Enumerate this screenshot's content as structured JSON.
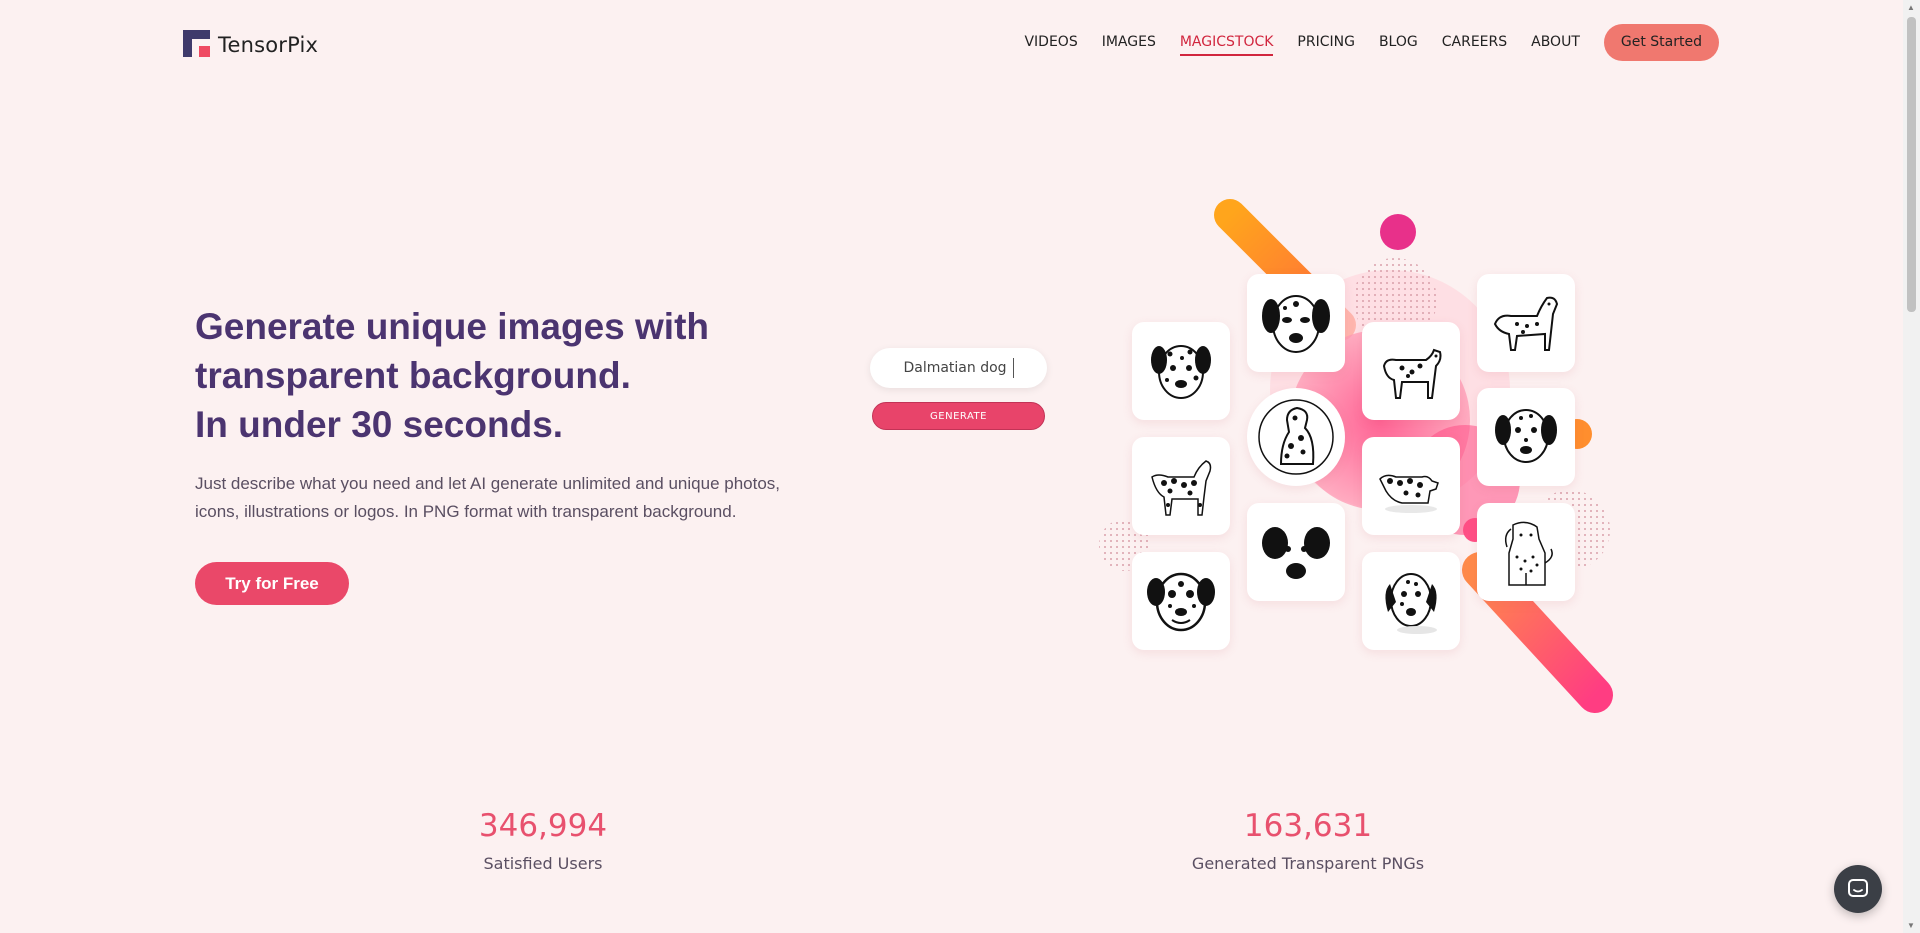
{
  "brand": {
    "name": "TensorPix"
  },
  "nav": {
    "items": [
      {
        "label": "VIDEOS"
      },
      {
        "label": "IMAGES"
      },
      {
        "label": "MAGICSTOCK",
        "active": true
      },
      {
        "label": "PRICING"
      },
      {
        "label": "BLOG"
      },
      {
        "label": "CAREERS"
      },
      {
        "label": "ABOUT"
      }
    ],
    "cta_label": "Get Started"
  },
  "hero": {
    "title_lines": [
      "Generate unique images with",
      "transparent background.",
      "In under 30 seconds."
    ],
    "description_lines": [
      "Just describe what you need and let AI generate unlimited and unique photos,",
      "icons, illustrations or logos. In PNG format with transparent background."
    ],
    "cta_label": "Try for Free"
  },
  "generator": {
    "prompt_value": "Dalmatian dog",
    "button_label": "GENERATE"
  },
  "gallery": {
    "tiles": [
      {
        "icon": "dalmatian-face-icon"
      },
      {
        "icon": "dalmatian-face-icon"
      },
      {
        "icon": "dalmatian-standing-icon"
      },
      {
        "icon": "dalmatian-outline-icon"
      },
      {
        "icon": "dalmatian-sitting-icon"
      },
      {
        "icon": "dalmatian-face-icon"
      },
      {
        "icon": "dalmatian-standing-icon"
      },
      {
        "icon": "dalmatian-standing-icon"
      },
      {
        "icon": "dalmatian-face-icon"
      },
      {
        "icon": "dalmatian-outline-icon"
      },
      {
        "icon": "dalmatian-face-icon"
      },
      {
        "icon": "dalmatian-face-icon"
      }
    ]
  },
  "stats": [
    {
      "value": "346,994",
      "label": "Satisfied Users"
    },
    {
      "value": "163,631",
      "label": "Generated Transparent PNGs"
    }
  ],
  "colors": {
    "background": "#fcf1f1",
    "title": "#4b3470",
    "accent": "#ea4869",
    "nav_active": "#d1263e",
    "cta": "#f0786f",
    "stat_number": "#e8516e"
  },
  "chat": {
    "icon": "chat-bubble-icon"
  }
}
